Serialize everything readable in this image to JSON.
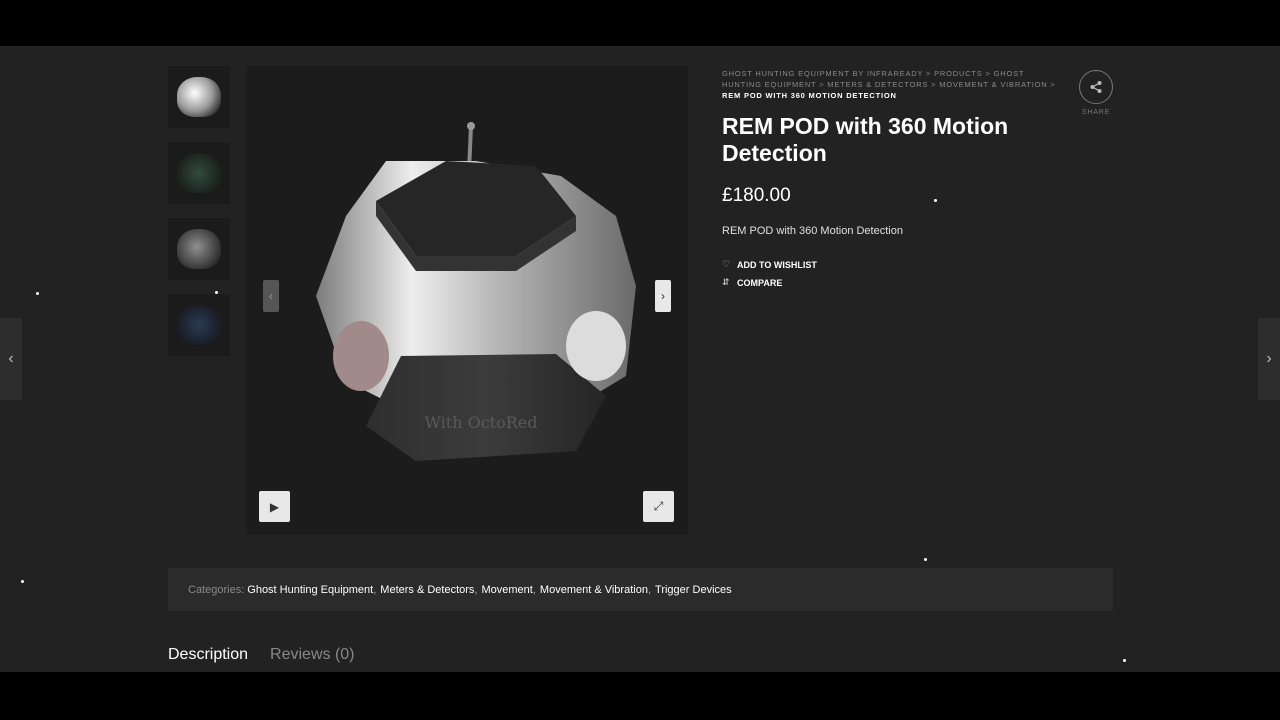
{
  "breadcrumb": {
    "items": [
      "Ghost Hunting Equipment by InfraReady",
      "Products",
      "Ghost Hunting Equipment",
      "Meters & Detectors",
      "Movement & Vibration"
    ],
    "separator": ">",
    "current": "REM POD with 360 Motion Detection"
  },
  "product": {
    "title": "REM POD with 360 Motion Detection",
    "price": "£180.00",
    "short_description": "REM POD with 360 Motion Detection",
    "wishlist_label": "ADD TO WISHLIST",
    "compare_label": "COMPARE"
  },
  "share": {
    "label": "SHARE"
  },
  "categories": {
    "label": "Categories:",
    "items": [
      "Ghost Hunting Equipment",
      "Meters & Detectors",
      "Movement",
      "Movement & Vibration",
      "Trigger Devices"
    ]
  },
  "tabs": [
    {
      "label": "Description",
      "active": true
    },
    {
      "label": "Reviews (0)",
      "active": false
    }
  ],
  "icons": {
    "heart": "heart-icon",
    "compare": "compare-arrows-icon",
    "share": "share-icon",
    "play": "play-icon",
    "expand": "expand-icon",
    "prev": "chevron-left-icon",
    "next": "chevron-right-icon"
  },
  "colors": {
    "background": "#222223",
    "panel": "#2b2b2c",
    "text": "#ffffff",
    "muted": "#8a8a8a"
  }
}
